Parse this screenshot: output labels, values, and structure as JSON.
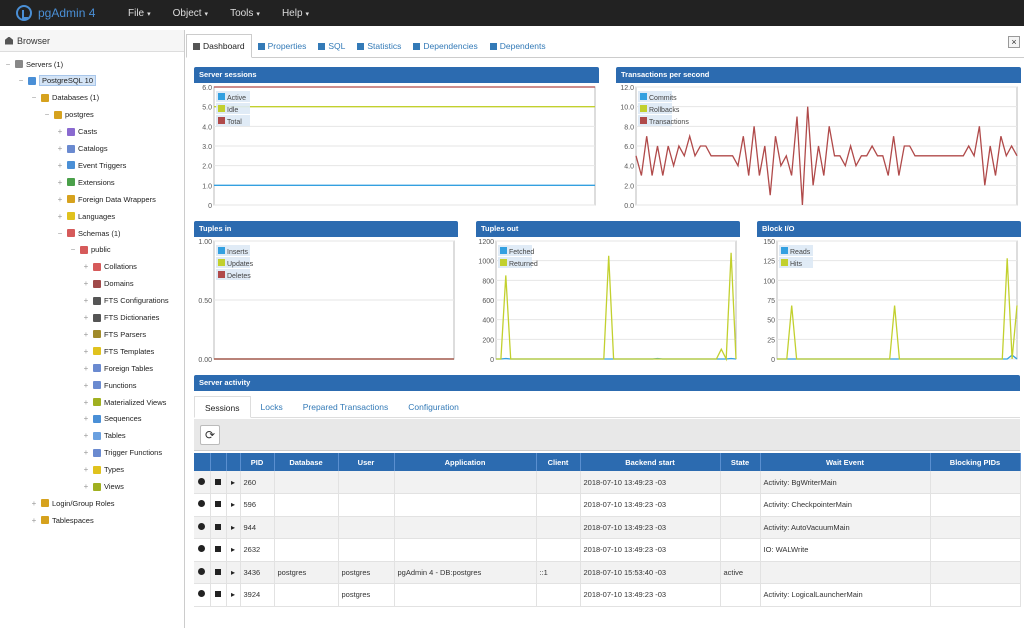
{
  "navbar": {
    "brand": "pgAdmin 4",
    "menus": [
      "File",
      "Object",
      "Tools",
      "Help"
    ]
  },
  "browser": {
    "title": "Browser",
    "tree": [
      {
        "label": "Servers (1)",
        "level": 0,
        "icon": "servers-icon",
        "color": "#888",
        "toggle": "−"
      },
      {
        "label": "PostgreSQL 10",
        "level": 1,
        "icon": "server-icon",
        "color": "#4a8fd6",
        "toggle": "−",
        "selected": true
      },
      {
        "label": "Databases (1)",
        "level": 2,
        "icon": "databases-icon",
        "color": "#d6a21e",
        "toggle": "−"
      },
      {
        "label": "postgres",
        "level": 3,
        "icon": "database-icon",
        "color": "#d6a21e",
        "toggle": "−"
      },
      {
        "label": "Casts",
        "level": 4,
        "icon": "casts-icon",
        "color": "#8a6ad0",
        "toggle": "+"
      },
      {
        "label": "Catalogs",
        "level": 4,
        "icon": "catalogs-icon",
        "color": "#6a8ad0",
        "toggle": "+"
      },
      {
        "label": "Event Triggers",
        "level": 4,
        "icon": "event-triggers-icon",
        "color": "#4a8fd6",
        "toggle": "+"
      },
      {
        "label": "Extensions",
        "level": 4,
        "icon": "extensions-icon",
        "color": "#4aa04a",
        "toggle": "+"
      },
      {
        "label": "Foreign Data Wrappers",
        "level": 4,
        "icon": "fdw-icon",
        "color": "#d6a21e",
        "toggle": "+"
      },
      {
        "label": "Languages",
        "level": 4,
        "icon": "languages-icon",
        "color": "#e0c21e",
        "toggle": "+"
      },
      {
        "label": "Schemas (1)",
        "level": 4,
        "icon": "schemas-icon",
        "color": "#d65a5a",
        "toggle": "−"
      },
      {
        "label": "public",
        "level": 5,
        "icon": "schema-icon",
        "color": "#d65a5a",
        "toggle": "−"
      },
      {
        "label": "Collations",
        "level": 6,
        "icon": "collations-icon",
        "color": "#d65a5a",
        "toggle": "+"
      },
      {
        "label": "Domains",
        "level": 6,
        "icon": "domains-icon",
        "color": "#a04a4a",
        "toggle": "+"
      },
      {
        "label": "FTS Configurations",
        "level": 6,
        "icon": "fts-configurations-icon",
        "color": "#555",
        "toggle": "+"
      },
      {
        "label": "FTS Dictionaries",
        "level": 6,
        "icon": "fts-dictionaries-icon",
        "color": "#555",
        "toggle": "+"
      },
      {
        "label": "FTS Parsers",
        "level": 6,
        "icon": "fts-parsers-icon",
        "color": "#a08a2a",
        "toggle": "+"
      },
      {
        "label": "FTS Templates",
        "level": 6,
        "icon": "fts-templates-icon",
        "color": "#e0c21e",
        "toggle": "+"
      },
      {
        "label": "Foreign Tables",
        "level": 6,
        "icon": "foreign-tables-icon",
        "color": "#6a8ad0",
        "toggle": "+"
      },
      {
        "label": "Functions",
        "level": 6,
        "icon": "functions-icon",
        "color": "#6a8ad0",
        "toggle": "+"
      },
      {
        "label": "Materialized Views",
        "level": 6,
        "icon": "materialized-views-icon",
        "color": "#a0b020",
        "toggle": "+"
      },
      {
        "label": "Sequences",
        "level": 6,
        "icon": "sequences-icon",
        "color": "#4a8fd6",
        "toggle": "+"
      },
      {
        "label": "Tables",
        "level": 6,
        "icon": "tables-icon",
        "color": "#6aa0e0",
        "toggle": "+"
      },
      {
        "label": "Trigger Functions",
        "level": 6,
        "icon": "trigger-functions-icon",
        "color": "#6a8ad0",
        "toggle": "+"
      },
      {
        "label": "Types",
        "level": 6,
        "icon": "types-icon",
        "color": "#e0c21e",
        "toggle": "+"
      },
      {
        "label": "Views",
        "level": 6,
        "icon": "views-icon",
        "color": "#a0b020",
        "toggle": "+"
      },
      {
        "label": "Login/Group Roles",
        "level": 2,
        "icon": "roles-icon",
        "color": "#d6a21e",
        "toggle": "+"
      },
      {
        "label": "Tablespaces",
        "level": 2,
        "icon": "tablespaces-icon",
        "color": "#d6a21e",
        "toggle": "+"
      }
    ]
  },
  "tabs": [
    "Dashboard",
    "Properties",
    "SQL",
    "Statistics",
    "Dependencies",
    "Dependents"
  ],
  "close_label": "×",
  "colors": {
    "header_blue": "#2c6bb0",
    "active": "#33a0e0",
    "idle": "#c2d02e",
    "total": "#b04a4a"
  },
  "chart_data": [
    {
      "type": "line",
      "title": "Server sessions",
      "ylim": [
        0,
        6.0
      ],
      "yticks": [
        "0",
        "1.0",
        "2.0",
        "3.0",
        "4.0",
        "5.0",
        "6.0"
      ],
      "series": [
        {
          "name": "Active",
          "color": "#33a0e0",
          "values": [
            1,
            1,
            1,
            1,
            1,
            1,
            1,
            1,
            1,
            1,
            1,
            1,
            1,
            1,
            1,
            1,
            1,
            1,
            1,
            1
          ]
        },
        {
          "name": "Idle",
          "color": "#c2d02e",
          "values": [
            5,
            5,
            5,
            5,
            5,
            5,
            5,
            5,
            5,
            5,
            5,
            5,
            5,
            5,
            5,
            5,
            5,
            5,
            5,
            5
          ]
        },
        {
          "name": "Total",
          "color": "#b04a4a",
          "values": [
            6,
            6,
            6,
            6,
            6,
            6,
            6,
            6,
            6,
            6,
            6,
            6,
            6,
            6,
            6,
            6,
            6,
            6,
            6,
            6
          ]
        }
      ]
    },
    {
      "type": "line",
      "title": "Transactions per second",
      "ylim": [
        0,
        12.0
      ],
      "yticks": [
        "0.0",
        "2.0",
        "4.0",
        "6.0",
        "8.0",
        "10.0",
        "12.0"
      ],
      "series": [
        {
          "name": "Commits",
          "color": "#33a0e0",
          "values": []
        },
        {
          "name": "Rollbacks",
          "color": "#c2d02e",
          "values": []
        },
        {
          "name": "Transactions",
          "color": "#b04a4a",
          "values": [
            5,
            3,
            7,
            3,
            6,
            3,
            6,
            4,
            6,
            5,
            7,
            5,
            6,
            6,
            5,
            5,
            5,
            5,
            5,
            4,
            7,
            3,
            8,
            3,
            6,
            1,
            7,
            4,
            5,
            3,
            9,
            0,
            10,
            2,
            6,
            3,
            8,
            5,
            5,
            4,
            6,
            4,
            5,
            5,
            6,
            5,
            5,
            3,
            7,
            3,
            6,
            6,
            5,
            5,
            5,
            5,
            5,
            5,
            5,
            5,
            5,
            5,
            6,
            5,
            8,
            2,
            6,
            3,
            7,
            5,
            6,
            5
          ]
        }
      ]
    },
    {
      "type": "line",
      "title": "Tuples in",
      "ylim": [
        0,
        1.0
      ],
      "yticks": [
        "0.00",
        "0.50",
        "1.00"
      ],
      "series": [
        {
          "name": "Inserts",
          "color": "#33a0e0",
          "values": [
            0,
            0,
            0,
            0,
            0,
            0,
            0,
            0,
            0,
            0
          ]
        },
        {
          "name": "Updates",
          "color": "#c2d02e",
          "values": [
            0,
            0,
            0,
            0,
            0,
            0,
            0,
            0,
            0,
            0
          ]
        },
        {
          "name": "Deletes",
          "color": "#b04a4a",
          "values": [
            0,
            0,
            0,
            0,
            0,
            0,
            0,
            0,
            0,
            0
          ]
        }
      ]
    },
    {
      "type": "line",
      "title": "Tuples out",
      "ylim": [
        0,
        1200
      ],
      "yticks": [
        "0",
        "200",
        "400",
        "600",
        "800",
        "1000",
        "1200"
      ],
      "series": [
        {
          "name": "Fetched",
          "color": "#33a0e0",
          "values": [
            0,
            0,
            5,
            0,
            0,
            0,
            0,
            0,
            0,
            0,
            0,
            0,
            0,
            0,
            0,
            0,
            0,
            0,
            0,
            0,
            0,
            0,
            0,
            0,
            0,
            0,
            0,
            0,
            0,
            0,
            0,
            0,
            0,
            5,
            0,
            0,
            0,
            0,
            0,
            0,
            0,
            0,
            0,
            0,
            0,
            0,
            0,
            0,
            5,
            0
          ]
        },
        {
          "name": "Returned",
          "color": "#c2d02e",
          "values": [
            0,
            0,
            850,
            0,
            0,
            0,
            0,
            0,
            0,
            0,
            0,
            0,
            0,
            0,
            0,
            0,
            0,
            0,
            0,
            0,
            0,
            0,
            0,
            1050,
            0,
            0,
            0,
            0,
            0,
            0,
            0,
            0,
            0,
            0,
            0,
            0,
            0,
            0,
            0,
            0,
            0,
            0,
            0,
            0,
            0,
            0,
            100,
            0,
            1080,
            0
          ]
        }
      ]
    },
    {
      "type": "line",
      "title": "Block I/O",
      "ylim": [
        0,
        150
      ],
      "yticks": [
        "0",
        "25",
        "50",
        "75",
        "100",
        "125",
        "150"
      ],
      "series": [
        {
          "name": "Reads",
          "color": "#33a0e0",
          "values": [
            0,
            0,
            0,
            0,
            0,
            0,
            0,
            0,
            0,
            0,
            0,
            0,
            0,
            0,
            0,
            0,
            0,
            0,
            0,
            0,
            0,
            0,
            0,
            0,
            0,
            0,
            0,
            0,
            0,
            0,
            0,
            0,
            0,
            0,
            0,
            0,
            0,
            0,
            0,
            0,
            0,
            0,
            0,
            0,
            0,
            0,
            0,
            0,
            5,
            0
          ]
        },
        {
          "name": "Hits",
          "color": "#c2d02e",
          "values": [
            0,
            0,
            0,
            68,
            0,
            0,
            0,
            0,
            0,
            0,
            0,
            0,
            0,
            0,
            0,
            0,
            0,
            0,
            0,
            0,
            0,
            0,
            0,
            0,
            68,
            0,
            0,
            0,
            0,
            0,
            0,
            0,
            0,
            0,
            0,
            0,
            0,
            0,
            0,
            0,
            0,
            0,
            0,
            0,
            0,
            0,
            0,
            128,
            0,
            68
          ]
        }
      ]
    }
  ],
  "server_activity": {
    "title": "Server activity",
    "tabs": [
      "Sessions",
      "Locks",
      "Prepared Transactions",
      "Configuration"
    ],
    "refresh_glyph": "⟳",
    "columns": [
      "",
      "",
      "",
      "PID",
      "Database",
      "User",
      "Application",
      "Client",
      "Backend start",
      "State",
      "Wait Event",
      "Blocking PIDs"
    ],
    "rows": [
      {
        "pid": "260",
        "database": "",
        "user": "",
        "application": "",
        "client": "",
        "backend_start": "2018-07-10 13:49:23 -03",
        "state": "",
        "wait_event": "Activity: BgWriterMain",
        "blocking": ""
      },
      {
        "pid": "596",
        "database": "",
        "user": "",
        "application": "",
        "client": "",
        "backend_start": "2018-07-10 13:49:23 -03",
        "state": "",
        "wait_event": "Activity: CheckpointerMain",
        "blocking": ""
      },
      {
        "pid": "944",
        "database": "",
        "user": "",
        "application": "",
        "client": "",
        "backend_start": "2018-07-10 13:49:23 -03",
        "state": "",
        "wait_event": "Activity: AutoVacuumMain",
        "blocking": ""
      },
      {
        "pid": "2632",
        "database": "",
        "user": "",
        "application": "",
        "client": "",
        "backend_start": "2018-07-10 13:49:23 -03",
        "state": "",
        "wait_event": "IO: WALWrite",
        "blocking": ""
      },
      {
        "pid": "3436",
        "database": "postgres",
        "user": "postgres",
        "application": "pgAdmin 4 - DB:postgres",
        "client": "::1",
        "backend_start": "2018-07-10 15:53:40 -03",
        "state": "active",
        "wait_event": "",
        "blocking": ""
      },
      {
        "pid": "3924",
        "database": "",
        "user": "postgres",
        "application": "",
        "client": "",
        "backend_start": "2018-07-10 13:49:23 -03",
        "state": "",
        "wait_event": "Activity: LogicalLauncherMain",
        "blocking": ""
      }
    ]
  }
}
